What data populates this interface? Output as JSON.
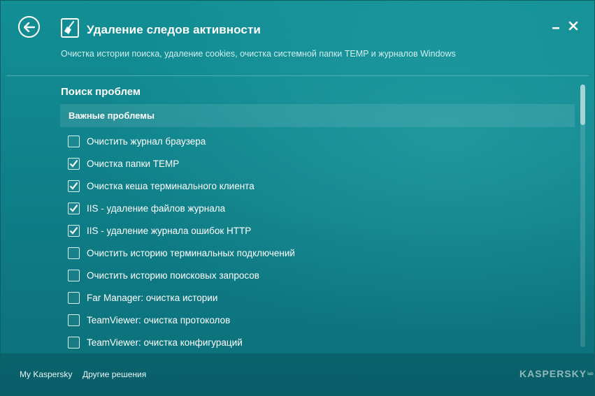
{
  "window": {
    "title": "Удаление следов активности",
    "subtitle": "Очистка истории поиска, удаление cookies, очистка системной папки TEMP и журналов Windows",
    "controls": {
      "minimize_icon": "minimize-icon",
      "close_icon": "close-icon"
    }
  },
  "section_title": "Поиск проблем",
  "group_header": "Важные проблемы",
  "items": [
    {
      "label": "Очистить журнал браузера",
      "checked": false
    },
    {
      "label": "Очистка папки TEMP",
      "checked": true
    },
    {
      "label": "Очистка кеша терминального клиента",
      "checked": true
    },
    {
      "label": "IIS - удаление файлов журнала",
      "checked": true
    },
    {
      "label": "IIS - удаление журнала ошибок HTTP",
      "checked": true
    },
    {
      "label": "Очистить историю терминальных подключений",
      "checked": false
    },
    {
      "label": "Очистить историю поисковых запросов",
      "checked": false
    },
    {
      "label": "Far Manager: очистка истории",
      "checked": false
    },
    {
      "label": "TeamViewer: очистка протоколов",
      "checked": false
    },
    {
      "label": "TeamViewer: очистка конфигураций",
      "checked": false
    }
  ],
  "footer": {
    "my_kaspersky": "My Kaspersky",
    "other_solutions": "Другие решения",
    "logo": "KASPERSKY",
    "logo_suffix": "lab"
  },
  "colors": {
    "background": "#0f8089",
    "text": "#ffffff",
    "accent": "#138f96"
  },
  "icons": {
    "back": "back-arrow-icon",
    "title": "broom-icon",
    "check": "checkmark-icon"
  }
}
